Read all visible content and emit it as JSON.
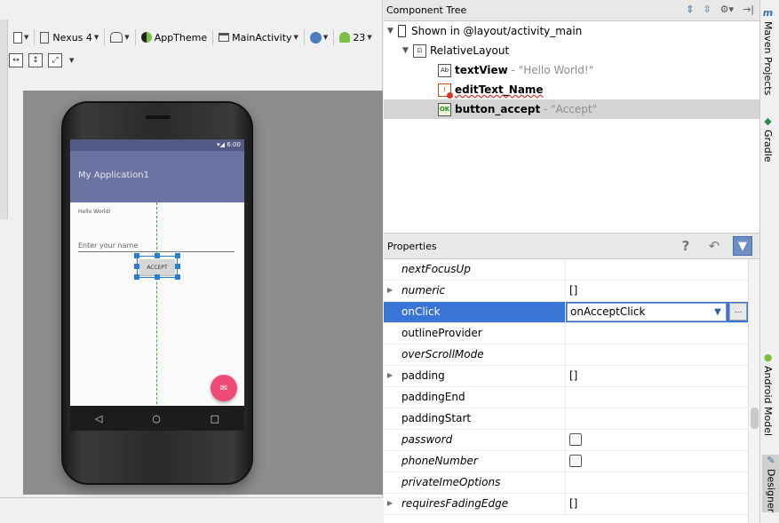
{
  "toolbar": {
    "device": "Nexus 4",
    "theme": "AppTheme",
    "activity": "MainActivity",
    "api": "23"
  },
  "preview": {
    "status_time": "6:00",
    "app_title": "My Application1",
    "hello_text": "Hello World!",
    "edit_hint": "Enter your name",
    "button_text": "ACCEPT"
  },
  "component_tree": {
    "title": "Component Tree",
    "shown_in": "Shown in @layout/activity_main",
    "layout": "RelativeLayout",
    "nodes": [
      {
        "id": "textView",
        "detail": "- \"Hello World!\"",
        "icon": "Ab"
      },
      {
        "id": "editText_Name",
        "detail": "",
        "icon": "I"
      },
      {
        "id": "button_accept",
        "detail": "- \"Accept\"",
        "icon": "OK"
      }
    ]
  },
  "properties": {
    "title": "Properties",
    "rows": [
      {
        "name": "nextFocusUp",
        "value": "",
        "italic": true,
        "expandable": false
      },
      {
        "name": "numeric",
        "value": "[]",
        "italic": true,
        "expandable": true
      },
      {
        "name": "onClick",
        "value": "onAcceptClick",
        "italic": false,
        "expandable": false
      },
      {
        "name": "outlineProvider",
        "value": "",
        "italic": false,
        "expandable": false
      },
      {
        "name": "overScrollMode",
        "value": "",
        "italic": true,
        "expandable": false
      },
      {
        "name": "padding",
        "value": "[]",
        "italic": false,
        "expandable": true
      },
      {
        "name": "paddingEnd",
        "value": "",
        "italic": false,
        "expandable": false
      },
      {
        "name": "paddingStart",
        "value": "",
        "italic": false,
        "expandable": false
      },
      {
        "name": "password",
        "value": "",
        "italic": true,
        "expandable": false
      },
      {
        "name": "phoneNumber",
        "value": "",
        "italic": true,
        "expandable": false
      },
      {
        "name": "privateImeOptions",
        "value": "",
        "italic": true,
        "expandable": false
      },
      {
        "name": "requiresFadingEdge",
        "value": "[]",
        "italic": true,
        "expandable": true
      }
    ],
    "combo_dots": "..."
  },
  "side_tabs": {
    "maven": "Maven Projects",
    "gradle": "Gradle",
    "android_model": "Android Model",
    "designer": "Designer"
  },
  "colors": {
    "selection_blue": "#3875d7",
    "app_bar": "#6b73a2",
    "fab": "#f04a76",
    "guide_green": "#3bab3b"
  }
}
